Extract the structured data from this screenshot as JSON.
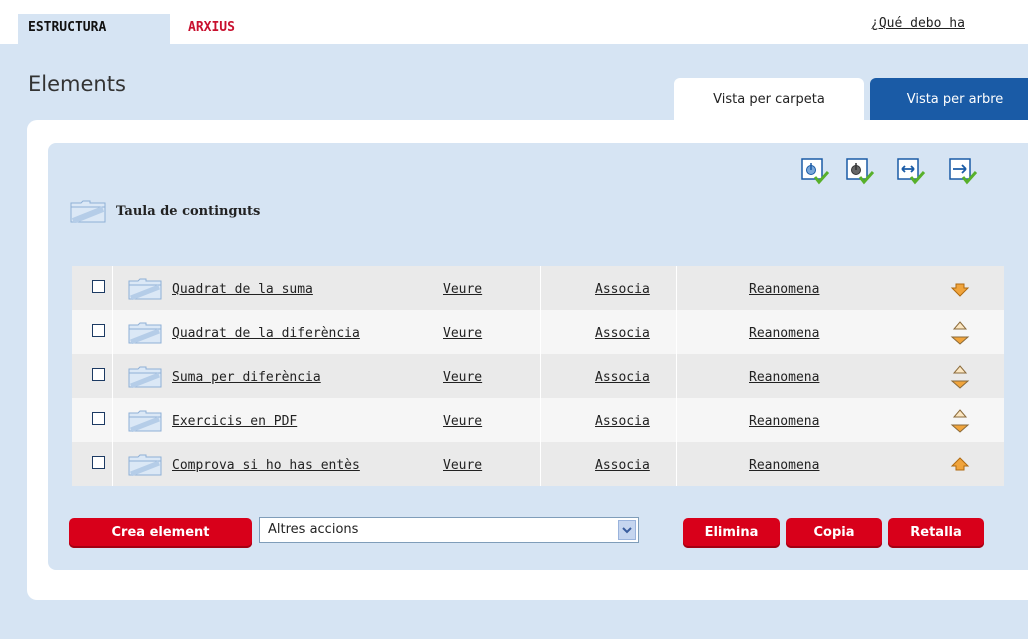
{
  "top_tabs": {
    "estructura": "ESTRUCTURA",
    "arxius": "ARXIUS"
  },
  "help_link": "¿Qué debo ha",
  "page_title": "Elements",
  "view_tabs": {
    "folder": "Vista per carpeta",
    "tree": "Vista per arbre"
  },
  "toolbar_icons": [
    "select-all-icon",
    "select-none-icon",
    "move-icon",
    "move-into-icon"
  ],
  "folder_title": "Taula de continguts",
  "rows": [
    {
      "name": "Quadrat de la suma",
      "view": "Veure",
      "associate": "Associa",
      "rename": "Reanomena",
      "arrows": "down"
    },
    {
      "name": "Quadrat de la diferència",
      "view": "Veure",
      "associate": "Associa",
      "rename": "Reanomena",
      "arrows": "both"
    },
    {
      "name": "Suma per diferència",
      "view": "Veure",
      "associate": "Associa",
      "rename": "Reanomena",
      "arrows": "both"
    },
    {
      "name": "Exercicis en PDF",
      "view": "Veure",
      "associate": "Associa",
      "rename": "Reanomena",
      "arrows": "both"
    },
    {
      "name": "Comprova si ho has entès",
      "view": "Veure",
      "associate": "Associa",
      "rename": "Reanomena",
      "arrows": "up"
    }
  ],
  "actions": {
    "create": "Crea element",
    "other_actions": "Altres accions",
    "delete": "Elimina",
    "copy": "Copia",
    "cut": "Retalla"
  },
  "colors": {
    "accent_red": "#d8001a",
    "tab_blue": "#1a5ba6",
    "panel_blue": "#d6e4f3",
    "arrow_orange": "#f0a43c"
  }
}
